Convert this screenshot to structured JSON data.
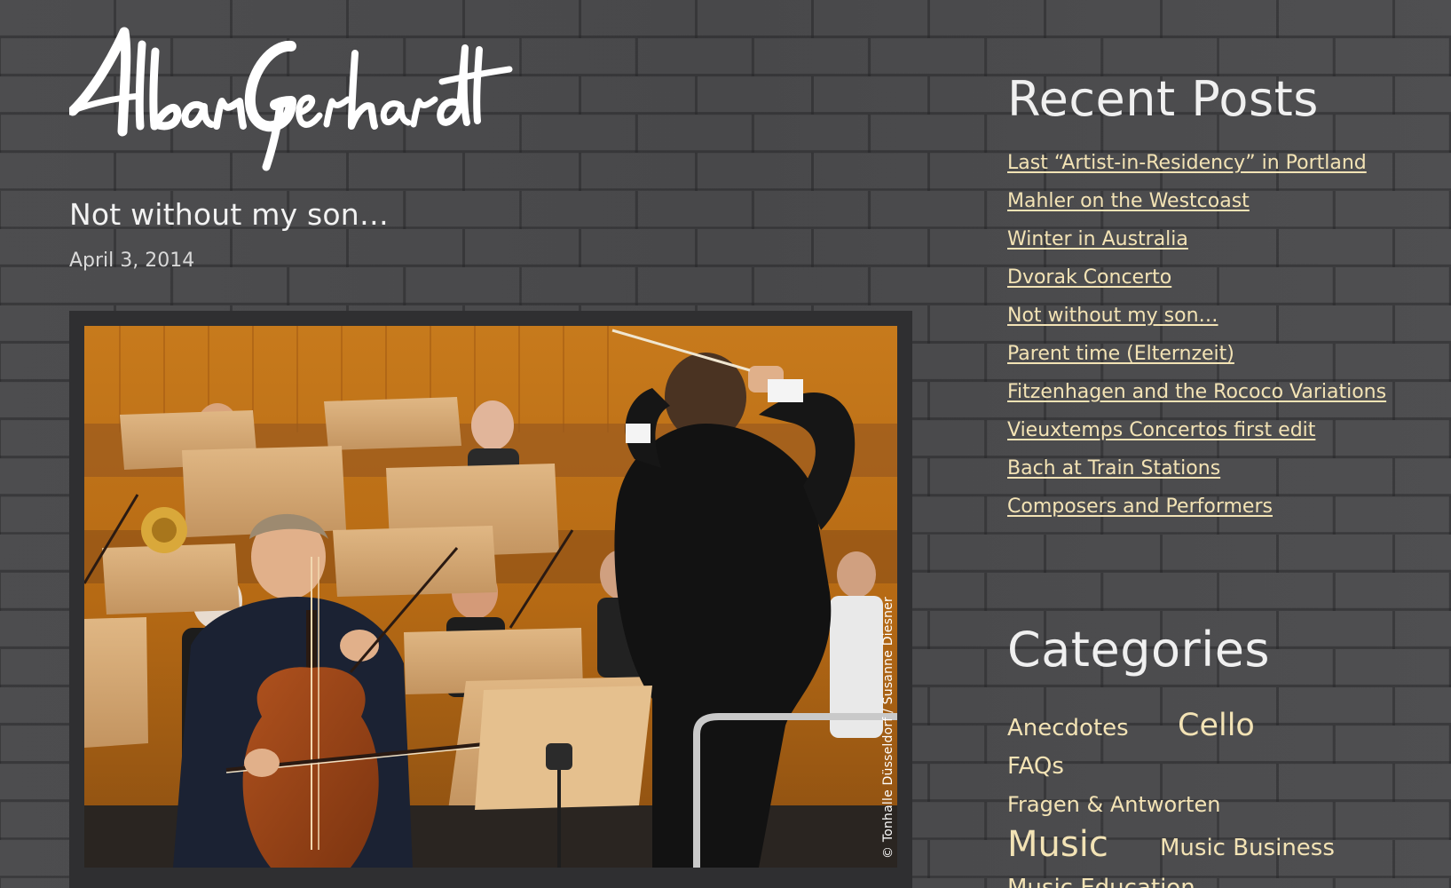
{
  "site": {
    "logo_text": "Alban Gerhardt"
  },
  "post": {
    "title": "Not without my son…",
    "date": "April 3, 2014",
    "photo_credit": "© Tonhalle Düsseldorf / Susanne Diesner"
  },
  "sidebar": {
    "recent_posts_title": "Recent Posts",
    "recent_posts": [
      "Last “Artist-in-Residency” in Portland",
      "Mahler on the Westcoast",
      "Winter in Australia",
      "Dvorak Concerto",
      "Not without my son…",
      "Parent time (Elternzeit)",
      "Fitzenhagen and the Rococo Variations",
      "Vieuxtemps Concertos first edit",
      "Bach at Train Stations",
      "Composers and Performers"
    ],
    "categories_title": "Categories",
    "categories": [
      "Anecdotes",
      "Cello",
      "FAQs",
      "Fragen & Antworten",
      "Music",
      "Music Business",
      "Music Education"
    ]
  },
  "colors": {
    "background": "#4b4b4d",
    "link": "#f3e3b5",
    "text": "#f2f2f2"
  }
}
